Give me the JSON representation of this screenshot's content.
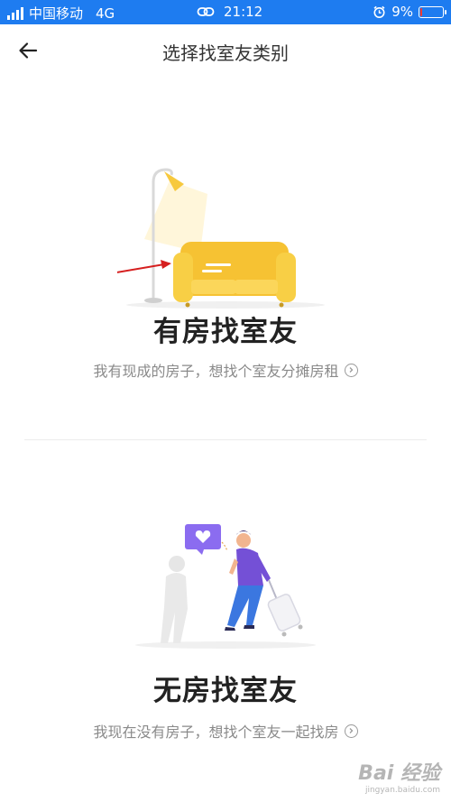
{
  "status_bar": {
    "carrier": "中国移动",
    "network": "4G",
    "time": "21:12",
    "battery": "9%",
    "battery_level": 0.09,
    "battery_color": "#ff3b30",
    "bar_color": "#1e7cf0"
  },
  "header": {
    "title": "选择找室友类别",
    "back_icon": "arrow-left-icon"
  },
  "options": [
    {
      "title": "有房找室友",
      "description": "我有现成的房子，想找个室友分摊房租",
      "illustration": "sofa-lamp",
      "chevron_icon": "chevron-right-circle-icon"
    },
    {
      "title": "无房找室友",
      "description": "我现在没有房子，想找个室友一起找房",
      "illustration": "traveler-with-suitcase",
      "chevron_icon": "chevron-right-circle-icon"
    }
  ],
  "watermark": {
    "main": "Bai 经验",
    "sub": "jingyan.baidu.com"
  }
}
